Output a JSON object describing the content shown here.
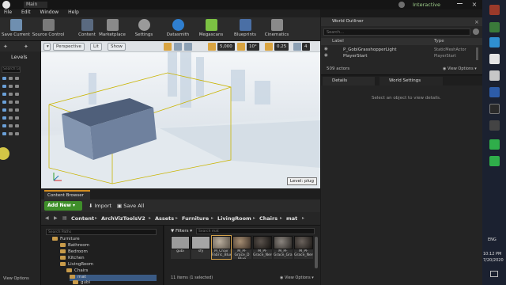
{
  "window": {
    "title": "Main",
    "interactive_label": "Interactive"
  },
  "menu": [
    "File",
    "Edit",
    "Window",
    "Help"
  ],
  "toolbar": [
    {
      "label": "Save Current",
      "icon": "save-icon",
      "color": "#6f8fb0"
    },
    {
      "label": "Source Control",
      "icon": "source-control-icon",
      "color": "#7a7a7a"
    },
    {
      "label": "Content",
      "icon": "content-icon",
      "color": "#5a6a80"
    },
    {
      "label": "Marketplace",
      "icon": "marketplace-icon",
      "color": "#8a8a8a"
    },
    {
      "label": "Settings",
      "icon": "gear-icon",
      "color": "#9a9a9a"
    },
    {
      "label": "Datasmith",
      "icon": "datasmith-icon",
      "color": "#2f7fd0"
    },
    {
      "label": "Megascans",
      "icon": "megascans-icon",
      "color": "#7cc243"
    },
    {
      "label": "Blueprints",
      "icon": "blueprints-icon",
      "color": "#4a6fa5"
    },
    {
      "label": "Cinematics",
      "icon": "cinematics-icon",
      "color": "#8a8a8a"
    }
  ],
  "levels": {
    "title": "Levels",
    "search_placeholder": "Search Le"
  },
  "viewport": {
    "perspective": "Perspective",
    "lit": "Lit",
    "show": "Show",
    "grid_snap": "5,000",
    "rotation_snap": "10°",
    "scale_snap": "0.25",
    "camera_speed": "4",
    "level_label": "Level: plug"
  },
  "content_browser": {
    "tab_label": "Content Browser",
    "add_new": "Add New",
    "import": "Import",
    "save_all": "Save All",
    "breadcrumbs": [
      "Content",
      "ArchVizToolsV2",
      "Assets",
      "Furniture",
      "LivingRoom",
      "Chairs",
      "mat"
    ],
    "search_paths_placeholder": "Search Paths",
    "filters": "Filters",
    "search_placeholder": "Search mat",
    "tree": [
      {
        "label": "Furniture",
        "depth": 0
      },
      {
        "label": "Bathroom",
        "depth": 1
      },
      {
        "label": "Bedroom",
        "depth": 1
      },
      {
        "label": "Kitchen",
        "depth": 1
      },
      {
        "label": "LivingRoom",
        "depth": 1
      },
      {
        "label": "Chairs",
        "depth": 2
      },
      {
        "label": "mat",
        "depth": 3
      },
      {
        "label": "gubi",
        "depth": 3
      }
    ],
    "assets": [
      {
        "name": "gubi",
        "color": "#9a9a9a"
      },
      {
        "name": "sfy",
        "color": "#a5a5a5"
      },
      {
        "name": "M_Chair Fabric_Blue",
        "color": "#8a7f70"
      },
      {
        "name": "M_PF Grace_D Blue",
        "color": "#6b5a4a"
      },
      {
        "name": "M_PF Grace_Nero",
        "color": "#2f2b28"
      },
      {
        "name": "M_PF Grace_Graphite",
        "color": "#5a5550"
      },
      {
        "name": "M_PF Grace_Nero",
        "color": "#3a3532"
      }
    ],
    "status": "11 items (1 selected)",
    "view_options": "View Options"
  },
  "outliner": {
    "tab_label": "World Outliner",
    "search_placeholder": "Search...",
    "col_label": "Label",
    "col_type": "Type",
    "rows": [
      {
        "label": "P_GobiGrasshopperLight",
        "type": "StaticMeshActor"
      },
      {
        "label": "PlayerStart",
        "type": "PlayerStart"
      }
    ],
    "count": "509 actors",
    "view_options": "View Options"
  },
  "details": {
    "tab_label": "Details",
    "world_settings": "World Settings",
    "empty_message": "Select an object to view details."
  },
  "taskbar": {
    "language": "ENG",
    "time": "10:12 PM",
    "date": "7/20/2020"
  }
}
